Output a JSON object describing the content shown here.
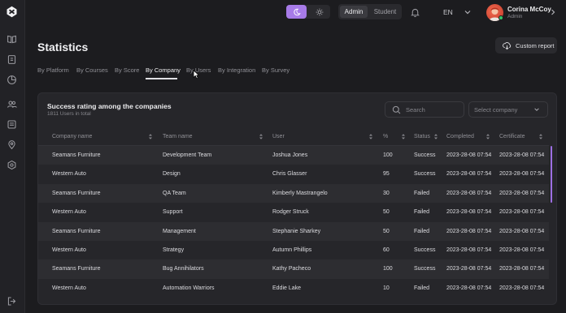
{
  "header": {
    "theme_modes": [
      "dark",
      "light"
    ],
    "roles": [
      "Admin",
      "Student"
    ],
    "active_role": "Admin",
    "language": "EN",
    "user_name": "Corina McCoy",
    "user_role": "Admin"
  },
  "sidebar": {
    "items": [
      "book-icon",
      "document-icon",
      "chart-icon",
      "users-icon",
      "list-icon",
      "location-icon",
      "settings-icon"
    ],
    "bottom": "logout-icon"
  },
  "page": {
    "title": "Statistics",
    "custom_report_label": "Custom report"
  },
  "tabs": [
    {
      "label": "By Platform"
    },
    {
      "label": "By Courses"
    },
    {
      "label": "By Score"
    },
    {
      "label": "By Company"
    },
    {
      "label": "By Users"
    },
    {
      "label": "By Integration"
    },
    {
      "label": "By Survey"
    }
  ],
  "active_tab": "By Company",
  "card": {
    "title": "Success rating among the companies",
    "subtitle": "1811 Users in total",
    "search_placeholder": "Search",
    "select_placeholder": "Select company"
  },
  "table": {
    "columns": [
      "Company name",
      "Team name",
      "User",
      "%",
      "Status",
      "Completed",
      "Certificate"
    ],
    "rows": [
      [
        "Seamans Furniture",
        "Development Team",
        "Joshua Jones",
        "100",
        "Success",
        "2023-28-08 07:54",
        "2023-28-08 07:54"
      ],
      [
        "Western Auto",
        "Design",
        "Chris Glasser",
        "95",
        "Success",
        "2023-28-08 07:54",
        "2023-28-08 07:54"
      ],
      [
        "Seamans Furniture",
        "QA Team",
        "Kimberly Mastrangelo",
        "30",
        "Failed",
        "2023-28-08 07:54",
        "2023-28-08 07:54"
      ],
      [
        "Western Auto",
        "Support",
        "Rodger Struck",
        "50",
        "Failed",
        "2023-28-08 07:54",
        "2023-28-08 07:54"
      ],
      [
        "Seamans Furniture",
        "Management",
        "Stephanie Sharkey",
        "50",
        "Failed",
        "2023-28-08 07:54",
        "2023-28-08 07:54"
      ],
      [
        "Western Auto",
        "Strategy",
        "Autumn Phillips",
        "60",
        "Success",
        "2023-28-08 07:54",
        "2023-28-08 07:54"
      ],
      [
        "Seamans Furniture",
        "Bug Annihilators",
        "Kathy Pacheco",
        "100",
        "Success",
        "2023-28-08 07:54",
        "2023-28-08 07:54"
      ],
      [
        "Western Auto",
        "Automation Warriors",
        "Eddie Lake",
        "10",
        "Failed",
        "2023-28-08 07:54",
        "2023-28-08 07:54"
      ]
    ]
  },
  "colors": {
    "accent": "#a77be8",
    "background": "#1c1c1f",
    "card": "#26262a"
  }
}
